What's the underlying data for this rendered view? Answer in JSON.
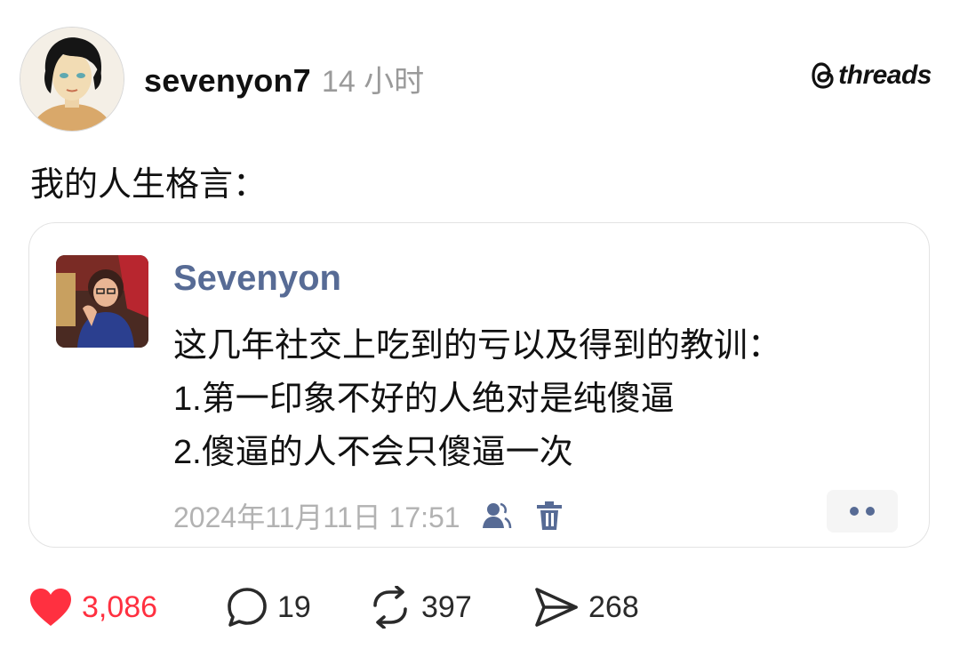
{
  "header": {
    "username": "sevenyon7",
    "time": "14 小时",
    "brand": "threads"
  },
  "post": {
    "text": "我的人生格言："
  },
  "quoted": {
    "name": "Sevenyon",
    "lines": [
      "这几年社交上吃到的亏以及得到的教训：",
      "1.第一印象不好的人绝对是纯傻逼",
      "2.傻逼的人不会只傻逼一次"
    ],
    "date": "2024年11月11日 17:51",
    "name_color": "#576b95"
  },
  "actions": {
    "likes": "3,086",
    "replies": "19",
    "reposts": "397",
    "shares": "268",
    "like_color": "#ff3040"
  },
  "icons": [
    "avatar",
    "threads-logo-icon",
    "privacy-contacts-icon",
    "trash-icon",
    "more-dots-icon",
    "heart-icon",
    "comment-icon",
    "repost-icon",
    "share-icon"
  ]
}
